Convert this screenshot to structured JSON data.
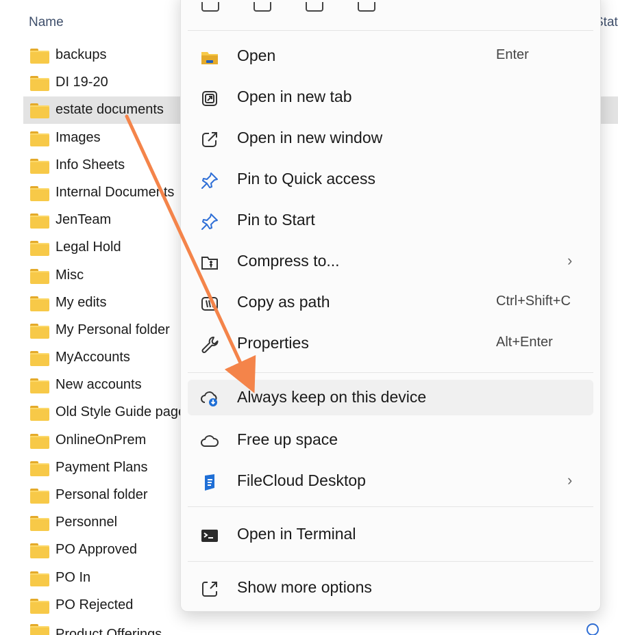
{
  "explorer": {
    "column_name": "Name",
    "column_status": "Statu",
    "folders": [
      {
        "name": "backups"
      },
      {
        "name": "DI 19-20"
      },
      {
        "name": "estate documents",
        "selected": true
      },
      {
        "name": "Images"
      },
      {
        "name": "Info Sheets"
      },
      {
        "name": "Internal Documents"
      },
      {
        "name": "JenTeam"
      },
      {
        "name": "Legal Hold"
      },
      {
        "name": "Misc"
      },
      {
        "name": "My edits"
      },
      {
        "name": "My Personal folder"
      },
      {
        "name": "MyAccounts"
      },
      {
        "name": "New accounts"
      },
      {
        "name": "Old Style Guide pages"
      },
      {
        "name": "OnlineOnPrem"
      },
      {
        "name": "Payment Plans"
      },
      {
        "name": "Personal folder"
      },
      {
        "name": "Personnel"
      },
      {
        "name": "PO Approved"
      },
      {
        "name": "PO In"
      },
      {
        "name": "PO Rejected"
      }
    ],
    "cut_off_row": "Product Offerings"
  },
  "context_menu": {
    "items": [
      {
        "label": "Open",
        "accelerator": "Enter",
        "icon": "folder-open-icon"
      },
      {
        "label": "Open in new tab",
        "accelerator": "",
        "icon": "new-tab-icon"
      },
      {
        "label": "Open in new window",
        "accelerator": "",
        "icon": "new-window-icon"
      },
      {
        "label": "Pin to Quick access",
        "accelerator": "",
        "icon": "pin-icon"
      },
      {
        "label": "Pin to Start",
        "accelerator": "",
        "icon": "pin-icon"
      },
      {
        "label": "Compress to...",
        "accelerator": "",
        "icon": "zip-icon",
        "submenu": true
      },
      {
        "label": "Copy as path",
        "accelerator": "Ctrl+Shift+C",
        "icon": "copy-path-icon"
      },
      {
        "label": "Properties",
        "accelerator": "Alt+Enter",
        "icon": "wrench-icon"
      },
      {
        "label": "Always keep on this device",
        "accelerator": "",
        "icon": "cloud-download-icon",
        "highlighted": true
      },
      {
        "label": "Free up space",
        "accelerator": "",
        "icon": "cloud-icon"
      },
      {
        "label": "FileCloud Desktop",
        "accelerator": "",
        "icon": "filecloud-icon",
        "submenu": true
      },
      {
        "label": "Open in Terminal",
        "accelerator": "",
        "icon": "terminal-icon"
      },
      {
        "label": "Show more options",
        "accelerator": "",
        "icon": "more-options-icon"
      }
    ]
  },
  "colors": {
    "arrow": "#f4844a",
    "selection": "#e3e3e3",
    "folder": "#f7c948",
    "accent": "#2f6fd6"
  }
}
